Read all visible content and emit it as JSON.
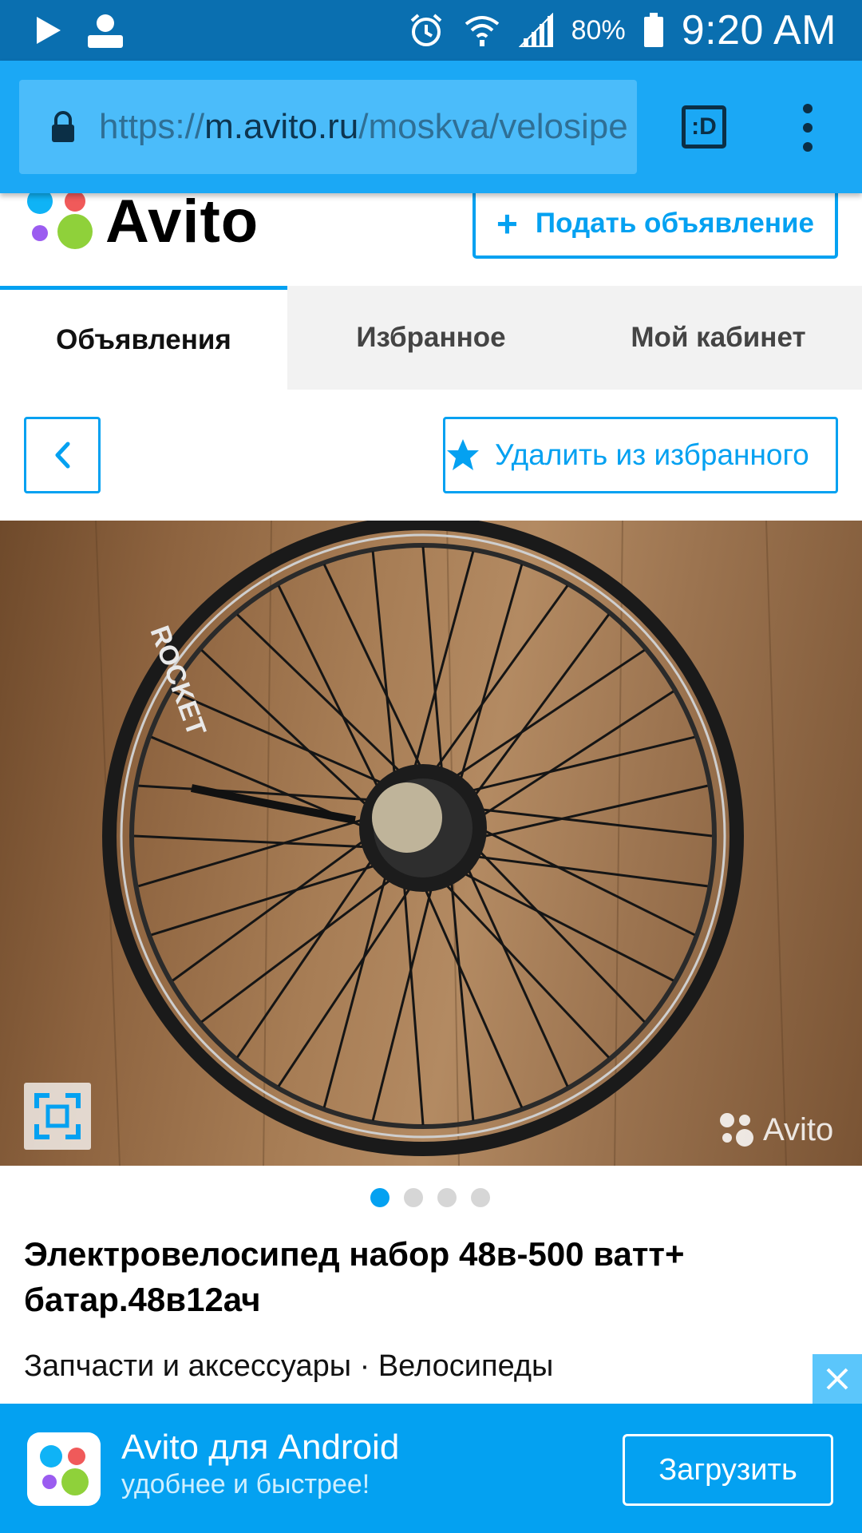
{
  "status_bar": {
    "battery": "80%",
    "time": "9:20 AM",
    "icons": [
      "play-icon",
      "user-icon",
      "alarm-icon",
      "wifi-icon",
      "signal-icon",
      "battery-icon"
    ]
  },
  "browser": {
    "url_scheme": "https://",
    "url_host": "m.avito.ru",
    "url_path": "/moskva/velosipe",
    "tab_label": ":D"
  },
  "header": {
    "logo_text": "Avito",
    "post_button": "Подать объявление"
  },
  "tabs": [
    {
      "label": "Объявления",
      "active": true
    },
    {
      "label": "Избранное",
      "active": false
    },
    {
      "label": "Мой кабинет",
      "active": false
    }
  ],
  "actions": {
    "favorite_button": "Удалить из избранного"
  },
  "gallery": {
    "watermark": "Avito",
    "image_count": 4,
    "current_index": 1
  },
  "listing": {
    "title": "Электровелосипед набор 48в-500 ватт+ батар.48в12ач",
    "category": "Запчасти и аксессуары",
    "separator": "·",
    "subcategory": "Велосипеды"
  },
  "banner": {
    "title": "Avito для Android",
    "subtitle": "удобнее и быстрее!",
    "button": "Загрузить"
  },
  "colors": {
    "accent": "#04a1f1",
    "status_bar": "#0a6fb0",
    "browser_bar": "#1ba8f5"
  }
}
